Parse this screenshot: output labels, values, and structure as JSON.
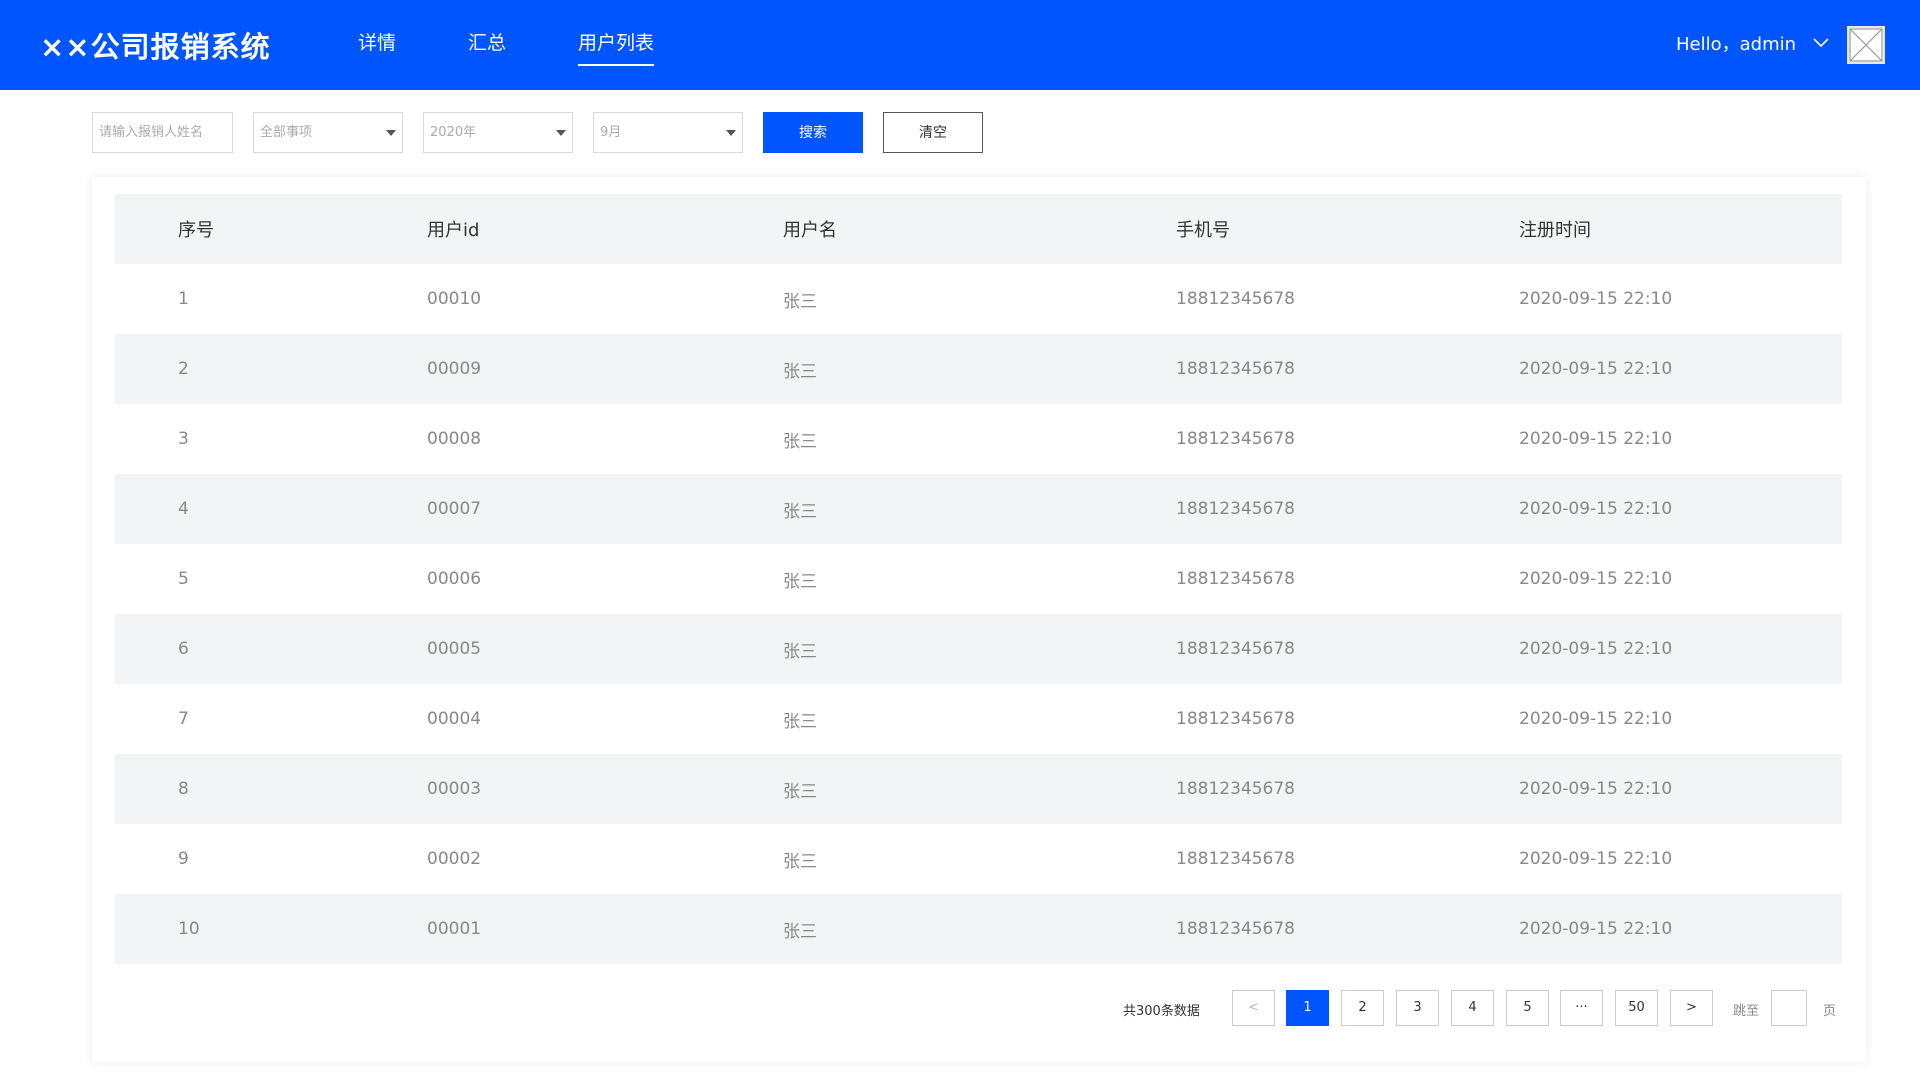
{
  "header": {
    "logo": "××公司报销系统",
    "nav": [
      {
        "label": "详情",
        "active": false
      },
      {
        "label": "汇总",
        "active": false
      },
      {
        "label": "用户列表",
        "active": true
      }
    ],
    "greeting": "Hello，admin",
    "brand_color": "#0055ff"
  },
  "filters": {
    "name_placeholder": "请输入报销人姓名",
    "category_selected": "全部事项",
    "year_selected": "2020年",
    "month_selected": "9月",
    "search_label": "搜索",
    "clear_label": "清空"
  },
  "table": {
    "columns": [
      "序号",
      "用户id",
      "用户名",
      "手机号",
      "注册时间"
    ],
    "rows": [
      [
        "1",
        "00010",
        "张三",
        "18812345678",
        "2020-09-15  22:10"
      ],
      [
        "2",
        "00009",
        "张三",
        "18812345678",
        "2020-09-15  22:10"
      ],
      [
        "3",
        "00008",
        "张三",
        "18812345678",
        "2020-09-15  22:10"
      ],
      [
        "4",
        "00007",
        "张三",
        "18812345678",
        "2020-09-15  22:10"
      ],
      [
        "5",
        "00006",
        "张三",
        "18812345678",
        "2020-09-15  22:10"
      ],
      [
        "6",
        "00005",
        "张三",
        "18812345678",
        "2020-09-15  22:10"
      ],
      [
        "7",
        "00004",
        "张三",
        "18812345678",
        "2020-09-15  22:10"
      ],
      [
        "8",
        "00003",
        "张三",
        "18812345678",
        "2020-09-15  22:10"
      ],
      [
        "9",
        "00002",
        "张三",
        "18812345678",
        "2020-09-15  22:10"
      ],
      [
        "10",
        "00001",
        "张三",
        "18812345678",
        "2020-09-15  22:10"
      ]
    ]
  },
  "pagination": {
    "total_text": "共300条数据",
    "prev": "<",
    "next": ">",
    "pages": [
      "1",
      "2",
      "3",
      "4",
      "5",
      "···",
      "50"
    ],
    "current": "1",
    "jump_label": "跳至",
    "jump_unit": "页"
  }
}
